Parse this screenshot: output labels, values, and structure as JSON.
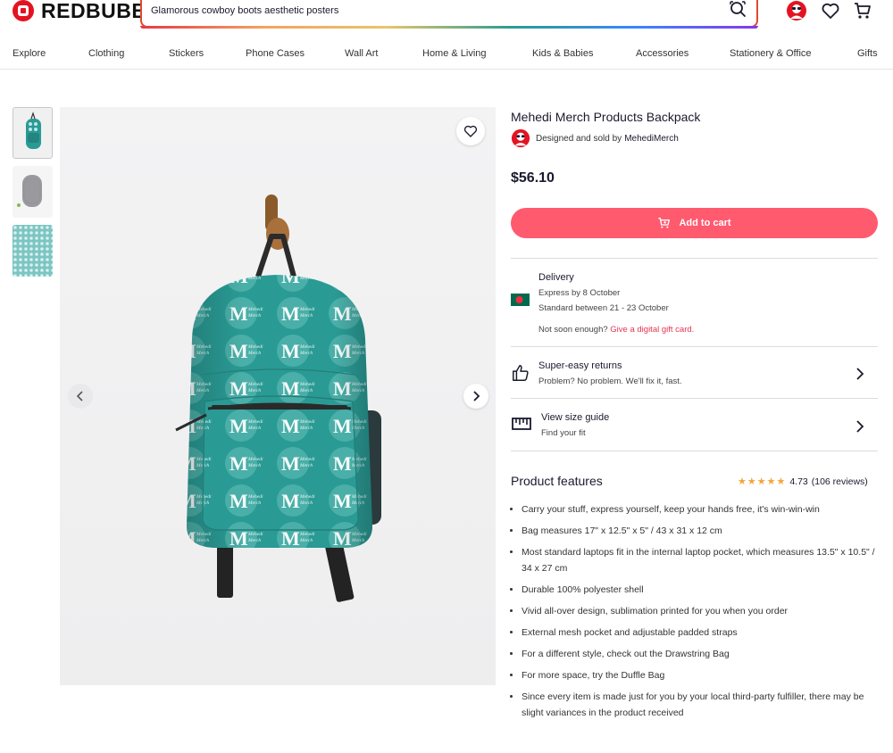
{
  "header": {
    "logo_text": "REDBUBBLE",
    "search_value": "Glamorous cowboy boots aesthetic posters"
  },
  "nav": {
    "items": [
      "Explore",
      "Clothing",
      "Stickers",
      "Phone Cases",
      "Wall Art",
      "Home & Living",
      "Kids & Babies",
      "Accessories",
      "Stationery & Office",
      "Gifts"
    ]
  },
  "product": {
    "title": "Mehedi Merch Products Backpack",
    "designed_by_prefix": "Designed and sold by",
    "seller": "MehediMerch",
    "price": "$56.10",
    "add_to_cart": "Add to cart"
  },
  "delivery": {
    "title": "Delivery",
    "express": "Express by 8 October",
    "standard": "Standard between 21 - 23 October",
    "not_soon": "Not soon enough?",
    "gift_link": "Give a digital gift card."
  },
  "returns": {
    "title": "Super-easy returns",
    "subtitle": "Problem? No problem. We'll fix it, fast."
  },
  "size_guide": {
    "title": "View size guide",
    "subtitle": "Find your fit"
  },
  "features": {
    "title": "Product features",
    "rating": "4.73",
    "reviews": "(106 reviews)",
    "stars": 4.73,
    "items": [
      "Carry your stuff, express yourself, keep your hands free, it's win-win-win",
      "Bag measures 17\" x 12.5\" x 5\" / 43 x 31 x 12 cm",
      "Most standard laptops fit in the internal laptop pocket, which measures 13.5\" x 10.5\" / 34 x 27 cm",
      "Durable 100% polyester shell",
      "Vivid all-over design, sublimation printed for you when you order",
      "External mesh pocket and adjustable padded straps",
      "For a different style, check out the Drawstring Bag",
      "For more space, try the Duffle Bag",
      "Since every item is made just for you by your local third-party fulfiller, there may be slight variances in the product received"
    ]
  },
  "colors": {
    "brand_red": "#e41321",
    "cart_button": "#ff5a6e",
    "link": "#e53552",
    "backpack_teal": "#2a9a94",
    "star": "#f2a63a"
  },
  "icons": [
    "search-icon",
    "user-avatar",
    "heart-icon",
    "cart-icon",
    "chevron-left-icon",
    "chevron-right-icon",
    "thumbs-up-icon",
    "ruler-icon",
    "flag-icon"
  ],
  "art": {
    "monogram_letter": "M",
    "monogram_words": [
      "Mehedi",
      "Merch"
    ]
  }
}
